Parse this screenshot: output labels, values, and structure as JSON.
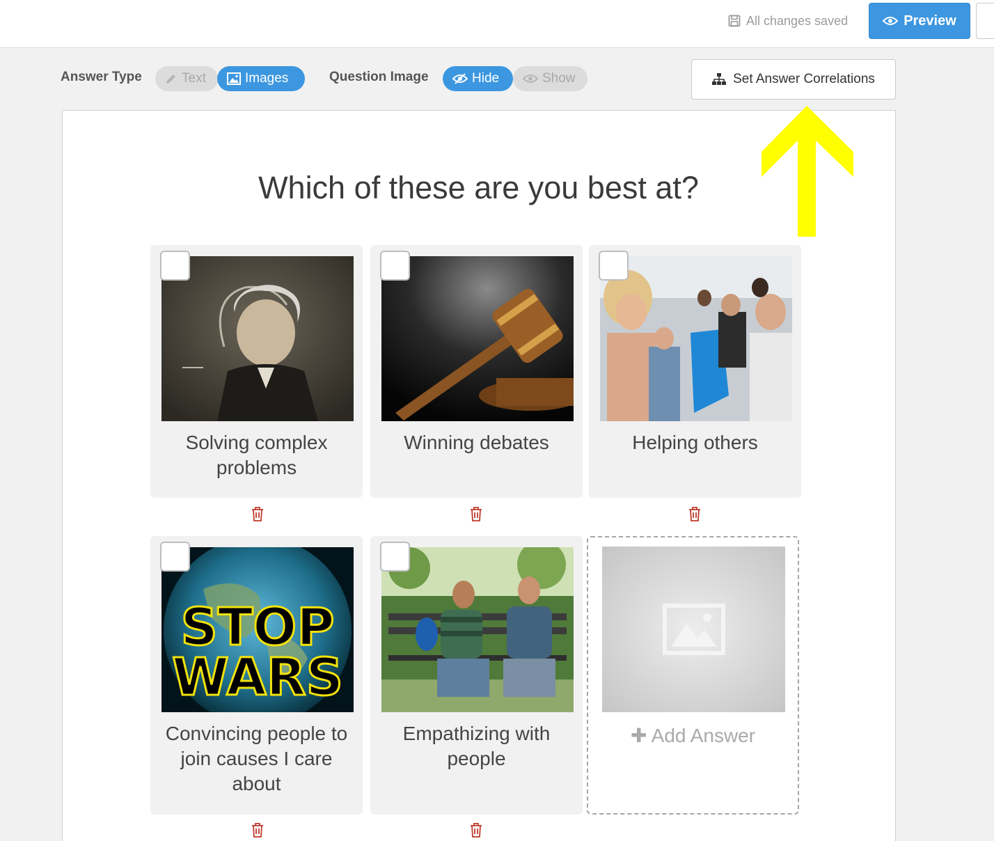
{
  "header": {
    "saved_status": "All changes saved",
    "preview_label": "Preview"
  },
  "toolbar": {
    "answer_type_label": "Answer Type",
    "answer_type_options": [
      {
        "label": "Text",
        "selected": false
      },
      {
        "label": "Images",
        "selected": true
      }
    ],
    "question_image_label": "Question Image",
    "question_image_options": [
      {
        "label": "Hide",
        "selected": true
      },
      {
        "label": "Show",
        "selected": false
      }
    ],
    "correlations_label": "Set Answer Correlations"
  },
  "question": {
    "title": "Which of these are you best at?"
  },
  "answers": [
    {
      "label": "Solving complex problems",
      "image": "einstein-chalkboard-photo",
      "checked": false
    },
    {
      "label": "Winning debates",
      "image": "gavel-photo",
      "checked": false
    },
    {
      "label": "Helping others",
      "image": "volunteers-children-photo",
      "checked": false
    },
    {
      "label": "Convincing people to join causes I care about",
      "image": "stop-wars-earth-graphic",
      "checked": false
    },
    {
      "label": "Empathizing with people",
      "image": "two-men-bench-photo",
      "checked": false
    }
  ],
  "add_answer": {
    "label": "Add Answer"
  },
  "colors": {
    "accent": "#3c97e0",
    "delete": "#c0392b",
    "arrow": "#ffff00"
  }
}
